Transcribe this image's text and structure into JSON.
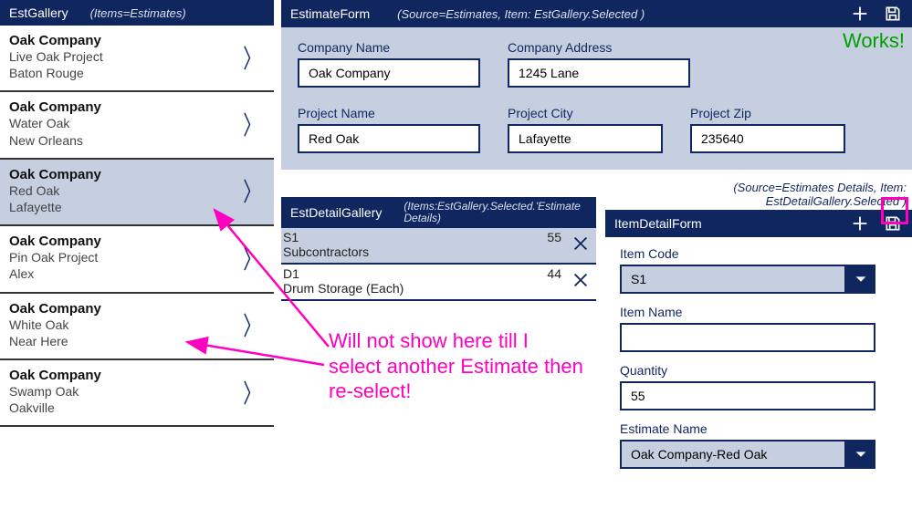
{
  "gallery": {
    "title": "EstGallery",
    "sub": "(Items=Estimates)",
    "items": [
      {
        "company": "Oak Company",
        "project": "Live Oak Project",
        "city": "Baton Rouge",
        "selected": false
      },
      {
        "company": "Oak Company",
        "project": "Water Oak",
        "city": "New Orleans",
        "selected": false
      },
      {
        "company": "Oak Company",
        "project": "Red Oak",
        "city": "Lafayette",
        "selected": true
      },
      {
        "company": "Oak Company",
        "project": "Pin Oak Project",
        "city": "Alex",
        "selected": false
      },
      {
        "company": "Oak Company",
        "project": "White Oak",
        "city": "Near Here",
        "selected": false
      },
      {
        "company": "Oak Company",
        "project": "Swamp Oak",
        "city": "Oakville",
        "selected": false
      }
    ]
  },
  "estForm": {
    "title": "EstimateForm",
    "sub": "(Source=Estimates,   Item: EstGallery.Selected )",
    "works_label": "Works!",
    "fields": {
      "company_label": "Company Name",
      "company_value": "Oak Company",
      "address_label": "Company Address",
      "address_value": "1245 Lane",
      "project_label": "Project Name",
      "project_value": "Red Oak",
      "city_label": "Project City",
      "city_value": "Lafayette",
      "zip_label": "Project Zip",
      "zip_value": "235640"
    }
  },
  "detailGallery": {
    "title": "EstDetailGallery",
    "sub": "(Items:EstGallery.Selected.'Estimate Details)",
    "items": [
      {
        "code": "S1",
        "name": "Subcontractors",
        "qty": "55",
        "selected": true
      },
      {
        "code": "D1",
        "name": "Drum Storage (Each)",
        "qty": "44",
        "selected": false
      }
    ]
  },
  "itemForm": {
    "above_note": "(Source=Estimates Details,  Item: EstDetailGallery.Selected )",
    "title": "ItemDetailForm",
    "fields": {
      "code_label": "Item Code",
      "code_value": "S1",
      "name_label": "Item Name",
      "name_value": "",
      "qty_label": "Quantity",
      "qty_value": "55",
      "est_label": "Estimate Name",
      "est_value": "Oak Company-Red Oak"
    }
  },
  "annotation": {
    "text": "Will not show here till I select another Estimate then re-select!"
  }
}
